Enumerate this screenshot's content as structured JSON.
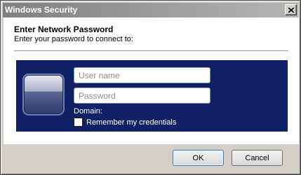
{
  "window": {
    "title": "Windows Security"
  },
  "content": {
    "heading": "Enter Network Password",
    "subheading": "Enter your password to connect to:"
  },
  "credentials": {
    "username_placeholder": "User name",
    "username_value": "",
    "password_placeholder": "Password",
    "password_value": "",
    "domain_label": "Domain:",
    "remember_label": "Remember my credentials",
    "remember_checked": false
  },
  "buttons": {
    "ok_label": "OK",
    "cancel_label": "Cancel"
  },
  "icons": {
    "close": "close-icon",
    "user_tile": "user-tile-icon"
  },
  "colors": {
    "panel_background": "#0f2164",
    "titlebar": "#808080"
  }
}
